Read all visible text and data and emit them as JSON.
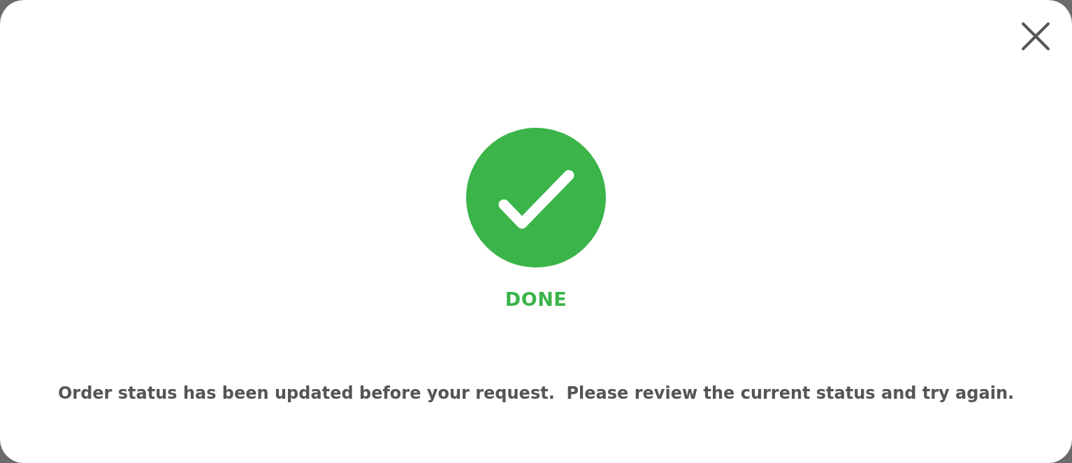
{
  "dialog": {
    "kind": "success",
    "title": "DONE",
    "message": "Order status has been updated before your request.  Please review the current status and try again."
  }
}
